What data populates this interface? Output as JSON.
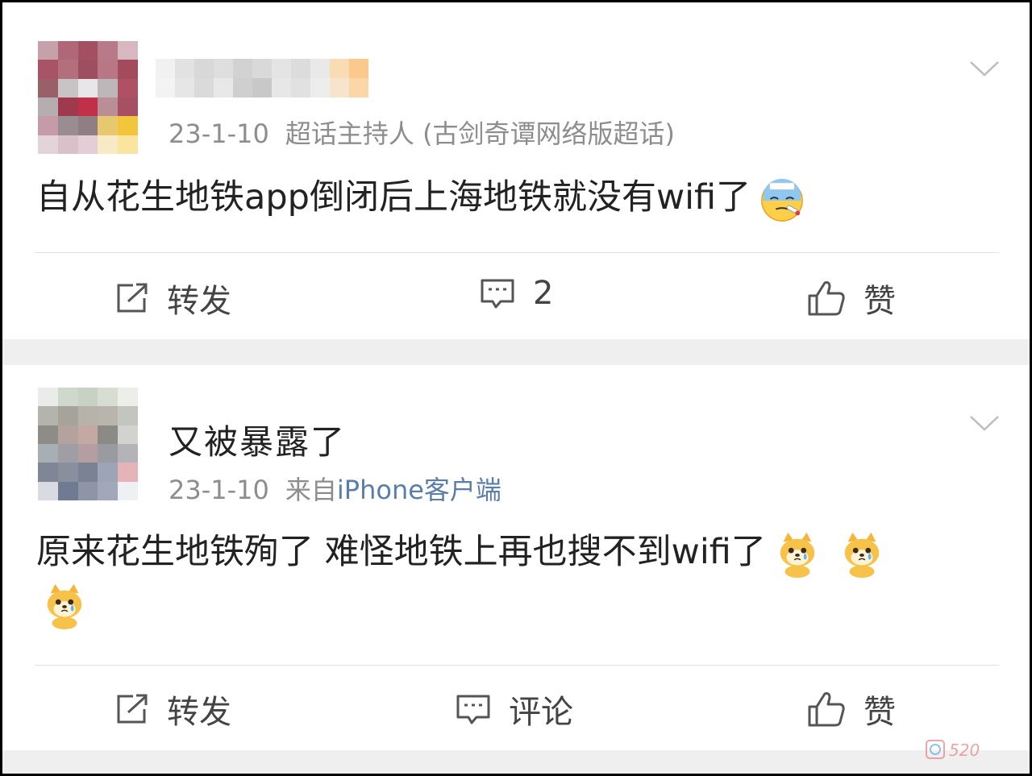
{
  "posts": [
    {
      "username": "",
      "date": "23-1-10",
      "source": "超话主持人 (古剑奇谭网络版超话)",
      "source_link": "",
      "text": "自从花生地铁app倒闭后上海地铁就没有wifi了",
      "emojis": [
        "sick-face-emoji"
      ],
      "actions": {
        "repost": "转发",
        "comment": "2",
        "like": "赞"
      }
    },
    {
      "username": "又被暴露了",
      "date": "23-1-10",
      "source": "来自",
      "source_link": "iPhone客户端",
      "text": "原来花生地铁殉了 难怪地铁上再也搜不到wifi了",
      "emojis": [
        "crying-doge-emoji",
        "crying-doge-emoji",
        "crying-doge-emoji"
      ],
      "actions": {
        "repost": "转发",
        "comment": "评论",
        "like": "赞"
      }
    }
  ],
  "watermark": "",
  "colors": {
    "link": "#5b7ea8",
    "meta": "#8d8d8d",
    "text": "#222222",
    "divider": "#e2e2e2",
    "gap": "#efefef"
  }
}
